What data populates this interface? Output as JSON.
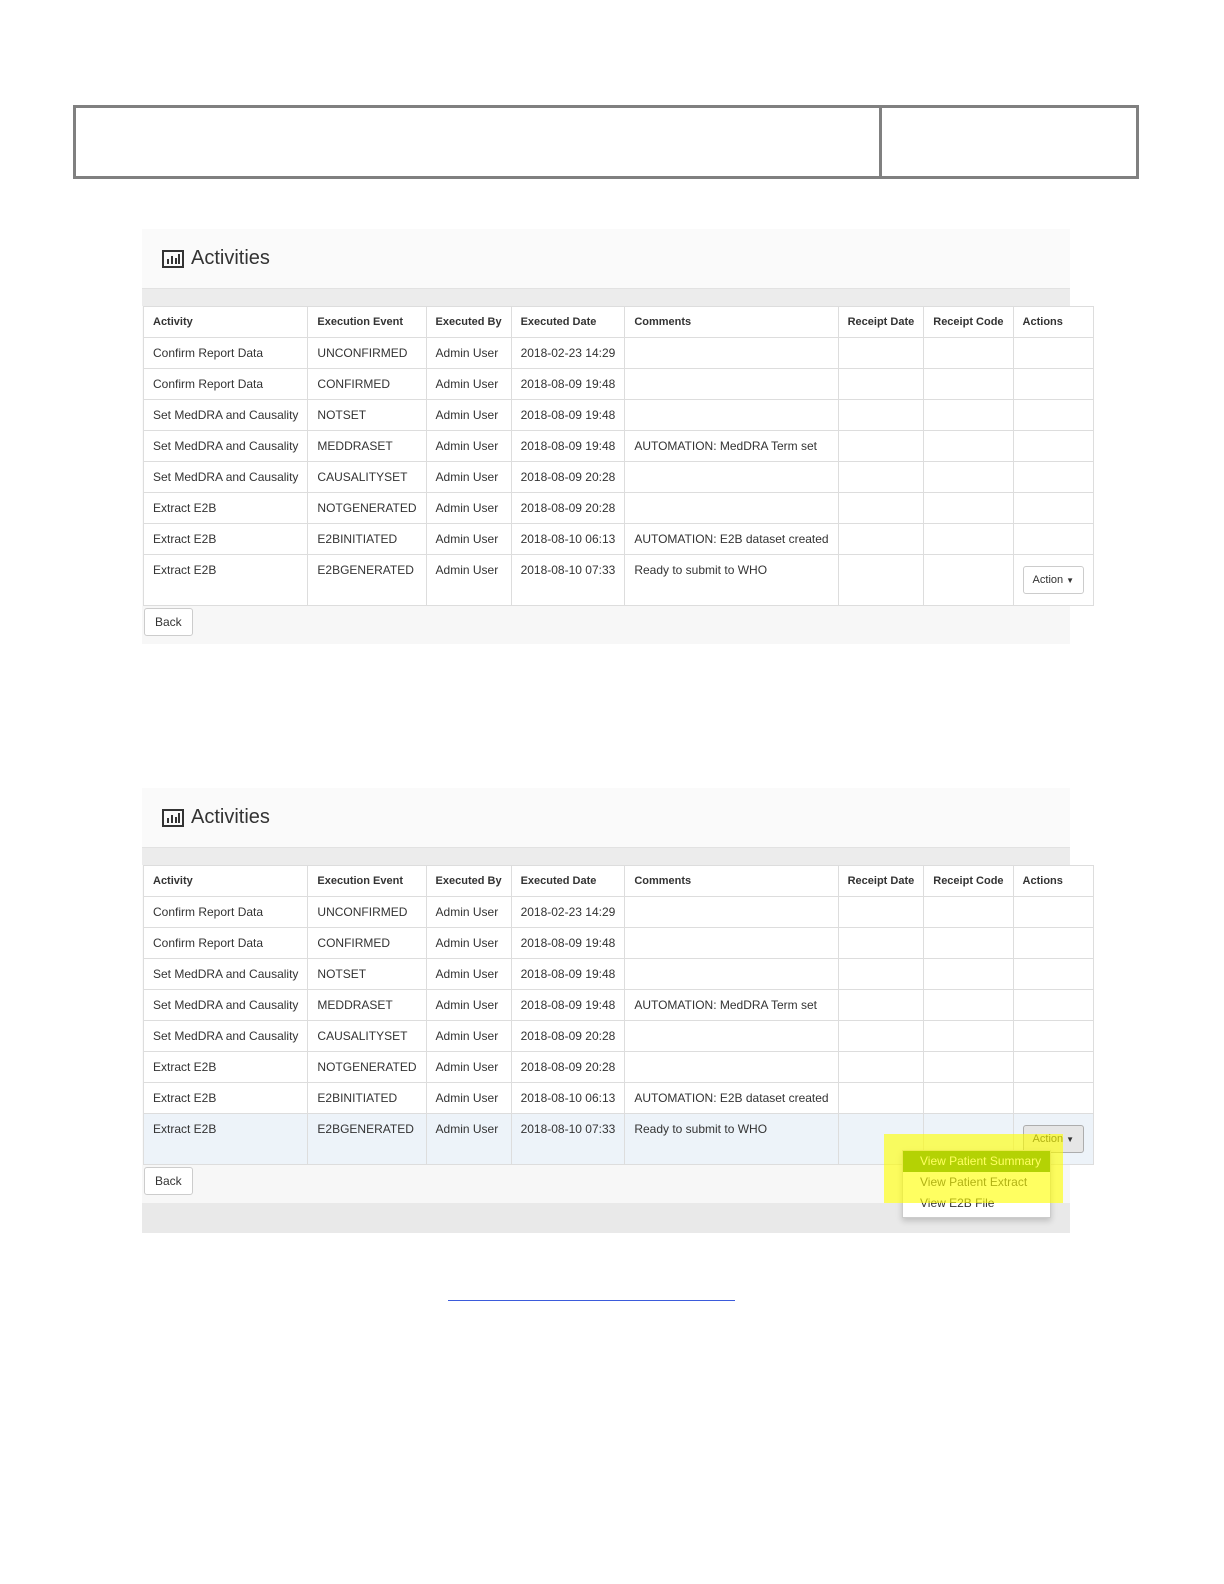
{
  "panel_title": "Activities",
  "columns": [
    "Activity",
    "Execution Event",
    "Executed By",
    "Executed Date",
    "Comments",
    "Receipt Date",
    "Receipt Code",
    "Actions"
  ],
  "rows": [
    {
      "activity": "Confirm Report Data",
      "event": "UNCONFIRMED",
      "by": "Admin User",
      "date": "2018-02-23 14:29",
      "comments": ""
    },
    {
      "activity": "Confirm Report Data",
      "event": "CONFIRMED",
      "by": "Admin User",
      "date": "2018-08-09 19:48",
      "comments": ""
    },
    {
      "activity": "Set MedDRA and Causality",
      "event": "NOTSET",
      "by": "Admin User",
      "date": "2018-08-09 19:48",
      "comments": ""
    },
    {
      "activity": "Set MedDRA and Causality",
      "event": "MEDDRASET",
      "by": "Admin User",
      "date": "2018-08-09 19:48",
      "comments": "AUTOMATION: MedDRA Term set"
    },
    {
      "activity": "Set MedDRA and Causality",
      "event": "CAUSALITYSET",
      "by": "Admin User",
      "date": "2018-08-09 20:28",
      "comments": ""
    },
    {
      "activity": "Extract E2B",
      "event": "NOTGENERATED",
      "by": "Admin User",
      "date": "2018-08-09 20:28",
      "comments": ""
    },
    {
      "activity": "Extract E2B",
      "event": "E2BINITIATED",
      "by": "Admin User",
      "date": "2018-08-10 06:13",
      "comments": "AUTOMATION: E2B dataset created"
    },
    {
      "activity": "Extract E2B",
      "event": "E2BGENERATED",
      "by": "Admin User",
      "date": "2018-08-10 07:33",
      "comments": "Ready to submit to WHO"
    }
  ],
  "action_label": "Action",
  "back_label": "Back",
  "dropdown_items": [
    "View Patient Summary",
    "View Patient Extract",
    "View E2B File"
  ],
  "colors": {
    "dropdown_active": "#3c8a0c",
    "highlight": "#ffff00",
    "row_highlight": "#edf3f9"
  }
}
